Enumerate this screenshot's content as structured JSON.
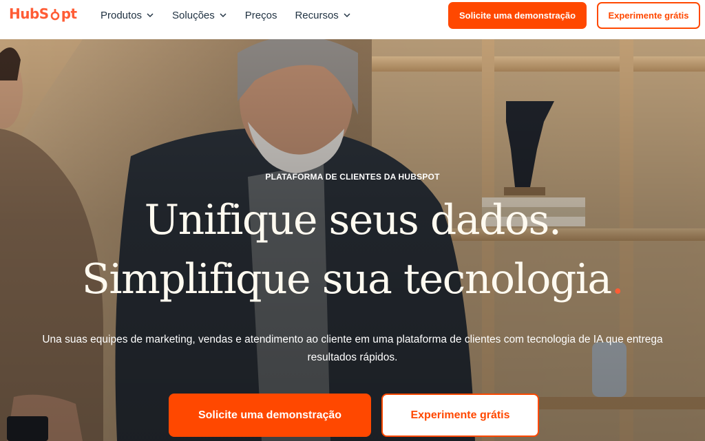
{
  "header": {
    "logo_text_left": "Hub",
    "logo_text_right": "pt",
    "nav": [
      {
        "label": "Produtos",
        "has_dropdown": true
      },
      {
        "label": "Soluções",
        "has_dropdown": true
      },
      {
        "label": "Preços",
        "has_dropdown": false
      },
      {
        "label": "Recursos",
        "has_dropdown": true
      }
    ],
    "primary_button": "Solicite uma demonstração",
    "secondary_button": "Experimente grátis"
  },
  "hero": {
    "eyebrow": "PLATAFORMA DE CLIENTES DA HUBSPOT",
    "headline_line1": "Unifique seus dados.",
    "headline_line2": "Simplifique sua tecnologia",
    "headline_dot": ".",
    "subtitle": "Una suas equipes de marketing, vendas e atendimento ao cliente em uma plataforma de clientes com tecnologia de IA que entrega resultados rápidos.",
    "primary_cta": "Solicite uma demonstração",
    "secondary_cta": "Experimente grátis"
  },
  "colors": {
    "brand_orange": "#ff4800",
    "logo_orange": "#ff5c35",
    "nav_text": "#213343",
    "headline_text": "#fffaf0"
  },
  "icons": {
    "chevron": "chevron-down-icon",
    "logo_sprocket": "hubspot-sprocket-icon"
  }
}
